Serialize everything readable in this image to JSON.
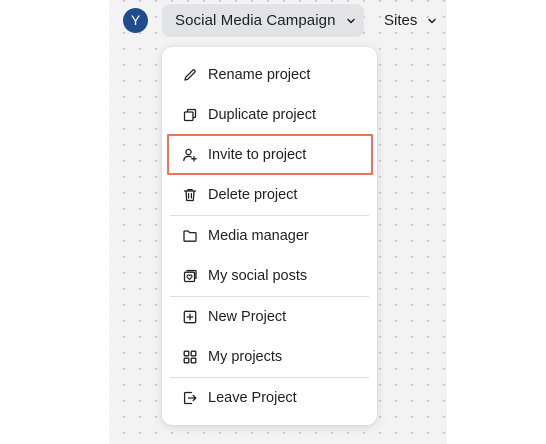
{
  "header": {
    "avatar_letter": "Y",
    "project_name": "Social Media Campaign",
    "sites_label": "Sites"
  },
  "menu": {
    "items": [
      {
        "label": "Rename project",
        "icon": "pencil-icon"
      },
      {
        "label": "Duplicate project",
        "icon": "duplicate-icon"
      },
      {
        "label": "Invite to project",
        "icon": "invite-user-icon"
      },
      {
        "label": "Delete project",
        "icon": "trash-icon"
      },
      {
        "label": "Media manager",
        "icon": "folder-icon"
      },
      {
        "label": "My social posts",
        "icon": "social-posts-icon"
      },
      {
        "label": "New Project",
        "icon": "plus-square-icon"
      },
      {
        "label": "My projects",
        "icon": "grid-icon"
      },
      {
        "label": "Leave Project",
        "icon": "exit-icon"
      }
    ]
  },
  "colors": {
    "highlight": "#e5765b",
    "avatar": "#1f4d8c",
    "switcher_bg": "#e1e3e6"
  }
}
